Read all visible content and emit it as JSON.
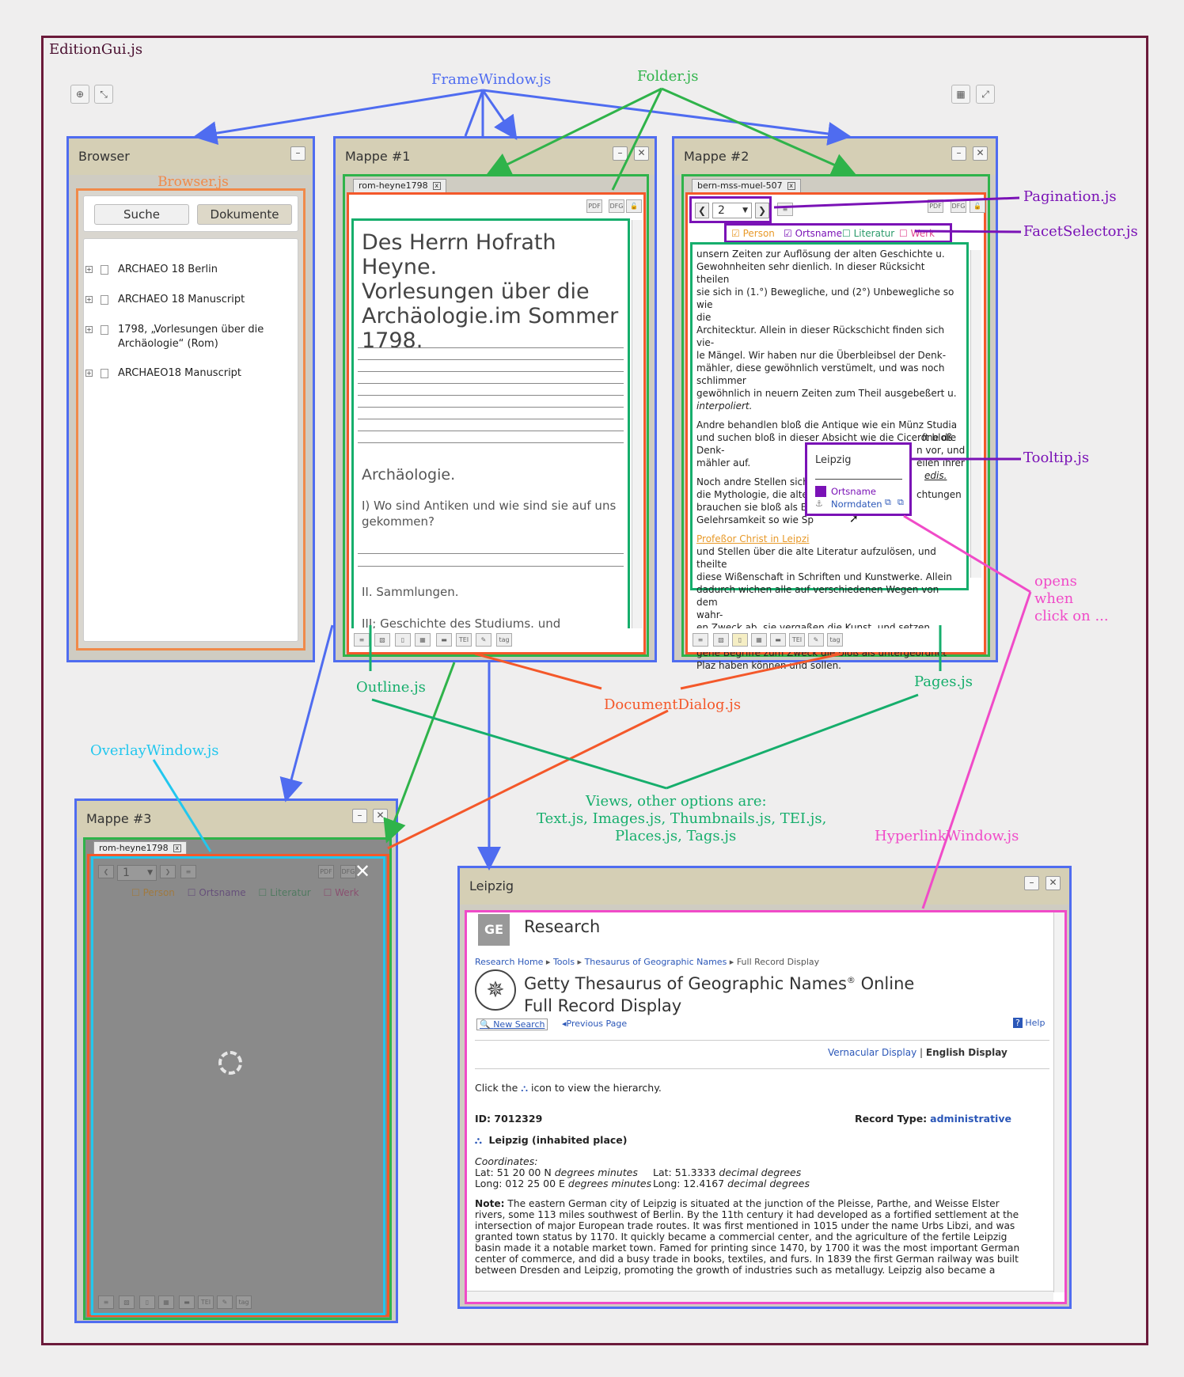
{
  "gui": {
    "title": "EditionGui.js"
  },
  "browser": {
    "title": "Browser",
    "label": "Browser.js",
    "tabs": {
      "search": "Suche",
      "documents": "Dokumente"
    },
    "items": [
      "ARCHAEO 18 Berlin",
      "ARCHAEO 18 Manuscript",
      "1798, „Vorlesungen über die",
      "Archäologie“ (Rom)",
      "ARCHAEO18 Manuscript"
    ]
  },
  "mappe1": {
    "title": "Mappe #1",
    "tab": "rom-heyne1798",
    "heading": [
      "Des Herrn Hofrath Heyne.",
      "Vorlesungen über die",
      "Archäologie.im Sommer",
      "1798."
    ],
    "section": "Archäologie.",
    "item1": "I) Wo sind Antiken und wie sind sie auf uns",
    "item1b": "gekommen?",
    "item2": "II. Sammlungen.",
    "item3": "III; Geschichte des Studiums. und Hülfsbücher."
  },
  "mappe2": {
    "title": "Mappe #2",
    "tab": "bern-mss-muel-507",
    "page": "2",
    "facets": [
      "Person",
      "Ortsname",
      "Literatur",
      "Werk"
    ],
    "lines": [
      "unsern Zeiten zur Auflösung der alten Geschichte u.",
      "Gewohnheiten sehr dienlich. In dieser Rücksicht theilen",
      "sie sich in (1.°) Bewegliche, und (2°) Unbewegliche so wie",
      "die",
      "Architecktur. Allein in dieser Rückschicht finden sich vie-",
      "le Mängel. Wir haben nur die Überbleibsel der Denk-",
      "mähler, diese gewöhnlich verstümelt, und was noch",
      "schlimmer",
      "gewöhnlich in neuern Zeiten zum Theil ausgebeßert u.",
      "interpoliert.",
      "Andre behandlen bloß die Antique wie ein Münz Studia",
      "und suchen bloß in dieser Absicht wie die Cicerone die",
      "Denk-",
      "mähler auf.",
      "Noch andre Stellen sich",
      "die Mythologie, die alte",
      "brauchen sie bloß als Er",
      "Gelehrsamkeit so wie Sp",
      "Profeßor Christ in Leipzi",
      "und Stellen über die alte Literatur aufzulösen, und theilte",
      "diese Wißenschaft in Schriften und Kunstwerke. Allein",
      "dadurch wichen alle auf verschiedenen Wegen von dem",
      "wahr-",
      "en Zweck ab, sie vergaßen die Kunst, und setzen hetero-",
      "gene Begriffe zum Zweck die bloß als untergeordnet",
      "Plaz haben können und sollen."
    ],
    "line_tails": [
      "ft bloß",
      "n vor, und",
      "eilen ihrer",
      "edis.",
      "chtungen"
    ]
  },
  "tooltip": {
    "title": "Leipzig",
    "type": "Ortsname",
    "link": "Normdaten"
  },
  "mappe3": {
    "title": "Mappe #3",
    "tab": "rom-heyne1798",
    "page": "1",
    "facets": [
      "Person",
      "Ortsname",
      "Literatur",
      "Werk"
    ]
  },
  "leipzig": {
    "title": "Leipzig",
    "research": "Research",
    "breadcrumb": [
      "Research Home",
      "Tools",
      "Thesaurus of Geographic Names",
      "Full Record Display"
    ],
    "heading1": "Getty Thesaurus of Geographic Names",
    "heading1b": "Online",
    "heading2": "Full Record Display",
    "new_search": "New Search",
    "prev_page": "Previous Page",
    "help": "Help",
    "vernacular": "Vernacular Display",
    "english": "English Display",
    "hint": "Click the",
    "hint2": "icon to view the hierarchy.",
    "id": "ID: 7012329",
    "record_type_label": "Record Type:",
    "record_type": "administrative",
    "place": "Leipzig (inhabited place)",
    "coords_label": "Coordinates:",
    "lat1": "Lat: 51 20 00 N",
    "lat1u": "degrees minutes",
    "lat2": "Lat: 51.3333",
    "lat2u": "decimal degrees",
    "long1": "Long: 012 25 00 E",
    "long1u": "degrees minutes",
    "long2": "Long: 12.4167",
    "long2u": "decimal degrees",
    "note_label": "Note:",
    "note": [
      "The eastern German city of Leipzig is situated at the junction of the Pleisse, Parthe, and Weisse Elster",
      "rivers, some 113 miles southwest of Berlin. By the 11th century it had developed as a fortified settlement at the",
      "intersection of major European trade routes. It was first mentioned in 1015 under the name Urbs Libzi, and was",
      "granted town status by 1170. It quickly became a commercial center, and the agriculture of the fertile Leipzig",
      "basin made it a notable market town. Famed for printing since 1470, by 1700 it was the most important German",
      "center of commerce, and did a busy trade in books, textiles, and furs. In 1839 the first German railway was built",
      "between Dresden and Leipzig, promoting the growth of industries such as metallugy. Leipzig also became a"
    ]
  },
  "labels": {
    "framewindow": "FrameWindow.js",
    "folder": "Folder.js",
    "pagination": "Pagination.js",
    "facetselector": "FacetSelector.js",
    "tooltip": "Tooltip.js",
    "outline": "Outline.js",
    "pages": "Pages.js",
    "documentdialog": "DocumentDialog.js",
    "overlaywindow": "OverlayWindow.js",
    "views1": "Views, other options are:",
    "views2": "Text.js, Images.js, Thumbnails.js, TEI.js,",
    "views3": "Places.js, Tags.js",
    "hyperlinkwindow": "HyperlinkWindow.js",
    "opens1": "opens",
    "opens2": "when",
    "opens3": "click on ..."
  },
  "colors": {
    "framewindow": "#4f6cf0",
    "folder": "#2fb34a",
    "documentdialog": "#f4582a",
    "views": "#16ae6c",
    "purple": "#7a12b6",
    "browser": "#f08a4a",
    "overlay": "#22c7ee",
    "hyperlink": "#f04bc8"
  }
}
